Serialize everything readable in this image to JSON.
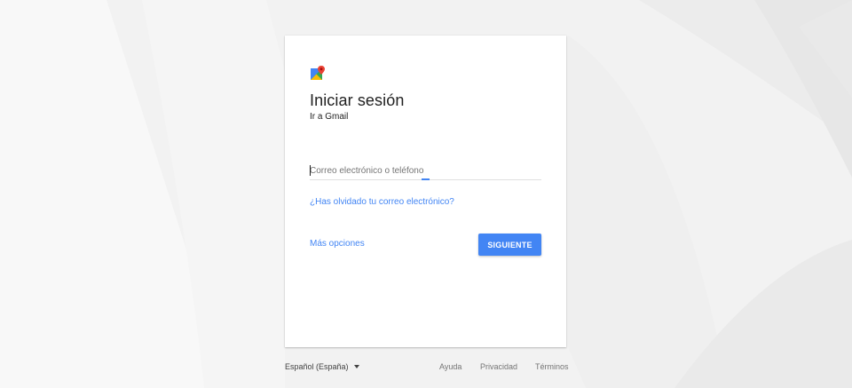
{
  "login": {
    "title": "Iniciar sesión",
    "subtitle": "Ir a Gmail",
    "email_placeholder": "Correo electrónico o teléfono",
    "email_value": "",
    "forgot_link": "¿Has olvidado tu correo electrónico?",
    "more_options": "Más opciones",
    "next_button": "SIGUIENTE"
  },
  "footer": {
    "language": "Español (España)",
    "links": [
      "Ayuda",
      "Privacidad",
      "Términos"
    ]
  },
  "icons": {
    "logo": "google-maps-icon",
    "language_dropdown": "caret-down-icon"
  },
  "colors": {
    "accent": "#4285f4",
    "background": "#f1f1f1",
    "card": "#ffffff",
    "text": "#212121"
  }
}
